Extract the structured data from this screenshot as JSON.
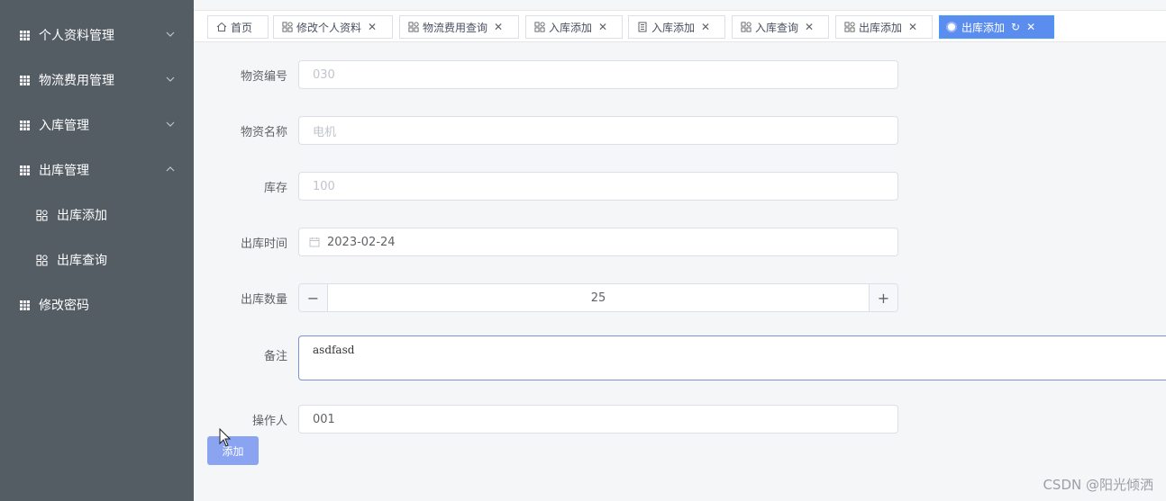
{
  "sidebar": {
    "items": [
      {
        "label": "个人资料管理",
        "expanded": false
      },
      {
        "label": "物流费用管理",
        "expanded": false
      },
      {
        "label": "入库管理",
        "expanded": false
      },
      {
        "label": "出库管理",
        "expanded": true,
        "children": [
          {
            "label": "出库添加"
          },
          {
            "label": "出库查询"
          }
        ]
      },
      {
        "label": "修改密码"
      }
    ]
  },
  "tabs": [
    {
      "label": "首页",
      "icon": "home-icon",
      "closable": false
    },
    {
      "label": "修改个人资料",
      "icon": "apps-icon",
      "closable": true
    },
    {
      "label": "物流费用查询",
      "icon": "apps-icon",
      "closable": true
    },
    {
      "label": "入库添加",
      "icon": "apps-icon",
      "closable": true
    },
    {
      "label": "入库添加",
      "icon": "building-icon",
      "closable": true
    },
    {
      "label": "入库查询",
      "icon": "apps-icon",
      "closable": true
    },
    {
      "label": "出库添加",
      "icon": "apps-icon",
      "closable": true
    },
    {
      "label": "出库添加",
      "icon": "dot-icon",
      "closable": true,
      "active": true
    }
  ],
  "close_glyph": "✕",
  "refresh_glyph": "↻",
  "form": {
    "code_label": "物资编号",
    "code_value": "030",
    "name_label": "物资名称",
    "name_value": "电机",
    "stock_label": "库存",
    "stock_value": "100",
    "date_label": "出库时间",
    "date_value": "2023-02-24",
    "qty_label": "出库数量",
    "qty_value": "25",
    "qty_minus": "−",
    "qty_plus": "+",
    "remark_label": "备注",
    "remark_value": "asdfasd",
    "operator_label": "操作人",
    "operator_value": "001",
    "submit_label": "添加"
  },
  "watermark": "CSDN @阳光倾洒",
  "colors": {
    "sidebar_bg": "#545c64",
    "active_tab": "#5b8def",
    "submit_button": "#8aa4f2"
  }
}
